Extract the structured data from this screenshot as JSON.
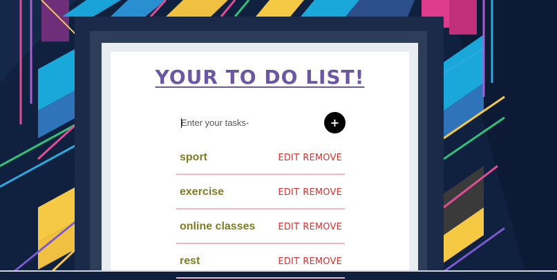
{
  "app": {
    "title": "YOUR TO DO LIST!",
    "input_placeholder": "Enter your tasks-",
    "add_button_label": "+"
  },
  "tasks": [
    {
      "name": "sport",
      "edit_label": "EDIT",
      "remove_label": "REMOVE"
    },
    {
      "name": "exercise",
      "edit_label": "EDIT",
      "remove_label": "REMOVE"
    },
    {
      "name": "online classes",
      "edit_label": "EDIT",
      "remove_label": "REMOVE"
    },
    {
      "name": "rest",
      "edit_label": "EDIT",
      "remove_label": "REMOVE"
    }
  ],
  "colors": {
    "title": "#6a58a3",
    "task_text": "#7d7e22",
    "action_text": "#d6312e",
    "divider": "#f2b8c6",
    "add_button": "#000000",
    "background": "#0f1f3d"
  }
}
